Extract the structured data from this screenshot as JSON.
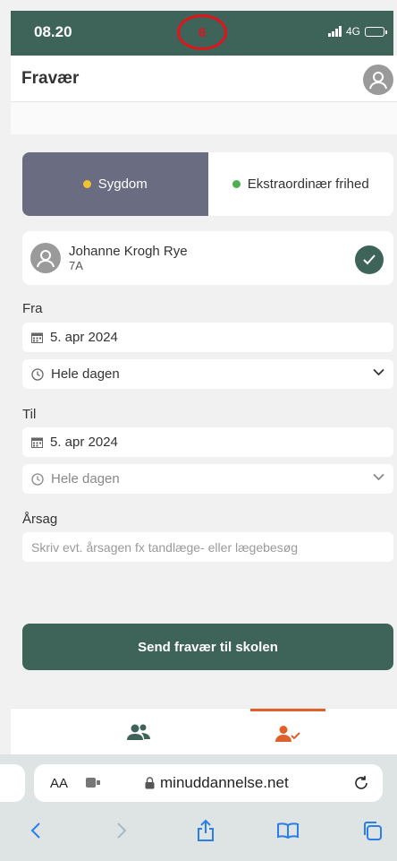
{
  "status_bar": {
    "time": "08.20",
    "badge": "6",
    "network": "4G"
  },
  "app_bar": {
    "title": "Fravær"
  },
  "absence_type": {
    "options": [
      {
        "label": "Sygdom",
        "dot_color": "#f1c232",
        "selected": true
      },
      {
        "label": "Ekstraordinær frihed",
        "dot_color": "#4caf50",
        "selected": false
      }
    ]
  },
  "student": {
    "name": "Johanne Krogh Rye",
    "class": "7A"
  },
  "from": {
    "label": "Fra",
    "date": "5. apr 2024",
    "time_option": "Hele dagen"
  },
  "to": {
    "label": "Til",
    "date": "5. apr 2024",
    "time_option": "Hele dagen"
  },
  "reason": {
    "label": "Årsag",
    "value": "",
    "placeholder": "Skriv evt. årsagen fx tandlæge- eller lægebesøg"
  },
  "submit": {
    "label": "Send fravær til skolen"
  },
  "tabbar": {
    "tabs": [
      {
        "icon": "group-icon",
        "active": false
      },
      {
        "icon": "person-check-icon",
        "active": true
      }
    ],
    "active_color": "#e0602c"
  },
  "browser": {
    "aa_label": "AA",
    "domain": "minuddannelse.net"
  },
  "colors": {
    "primary": "#3e6359",
    "segment_active": "#6a6c82"
  }
}
